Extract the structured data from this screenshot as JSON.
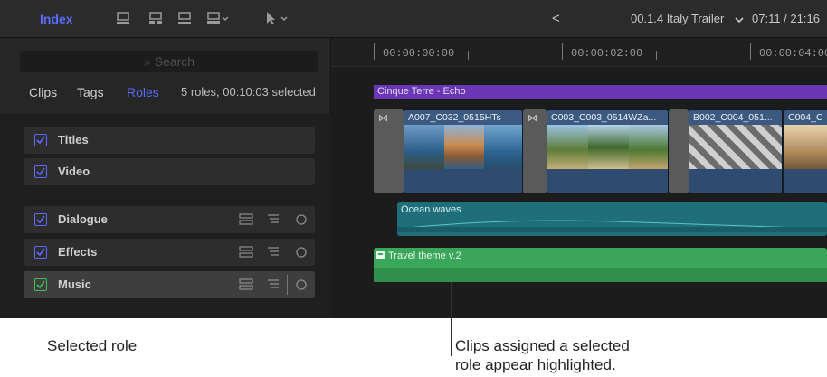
{
  "toolbar": {
    "index_button": "Index",
    "back_arrow": "<",
    "project_name": "00.1.4 Italy Trailer",
    "timecode": "07:11 / 21:16"
  },
  "index_panel": {
    "search_placeholder": "Search",
    "tabs": [
      "Clips",
      "Tags",
      "Roles"
    ],
    "active_tab": "Roles",
    "summary": "5 roles, 00:10:03 selected",
    "roles": [
      {
        "label": "Titles",
        "checked": true,
        "has_controls": false
      },
      {
        "label": "Video",
        "checked": true,
        "has_controls": false
      },
      {
        "label": "Dialogue",
        "checked": true,
        "has_controls": true
      },
      {
        "label": "Effects",
        "checked": true,
        "has_controls": true
      },
      {
        "label": "Music",
        "checked": true,
        "has_controls": true,
        "selected": true
      }
    ]
  },
  "timeline": {
    "ruler": [
      "00:00:00:00",
      "00:00:02:00",
      "00:00:04:00"
    ],
    "storyline": "Cinque Terre - Echo",
    "clips": [
      "A007_C032_0515HTs",
      "C003_C003_0514WZa...",
      "B002_C004_051...",
      "C004_C"
    ],
    "ocean_clip": "Ocean waves",
    "music_clip": "Travel theme v.2"
  },
  "annotations": {
    "selected_role": "Selected role",
    "highlight_line1": "Clips assigned a selected",
    "highlight_line2": "role appear highlighted."
  },
  "colors": {
    "accent": "#5a6cff",
    "storyline": "#6a36b5",
    "video_clip": "#3c5a80",
    "effects_clip": "#1f6f7a",
    "music_clip": "#3aa65a"
  }
}
